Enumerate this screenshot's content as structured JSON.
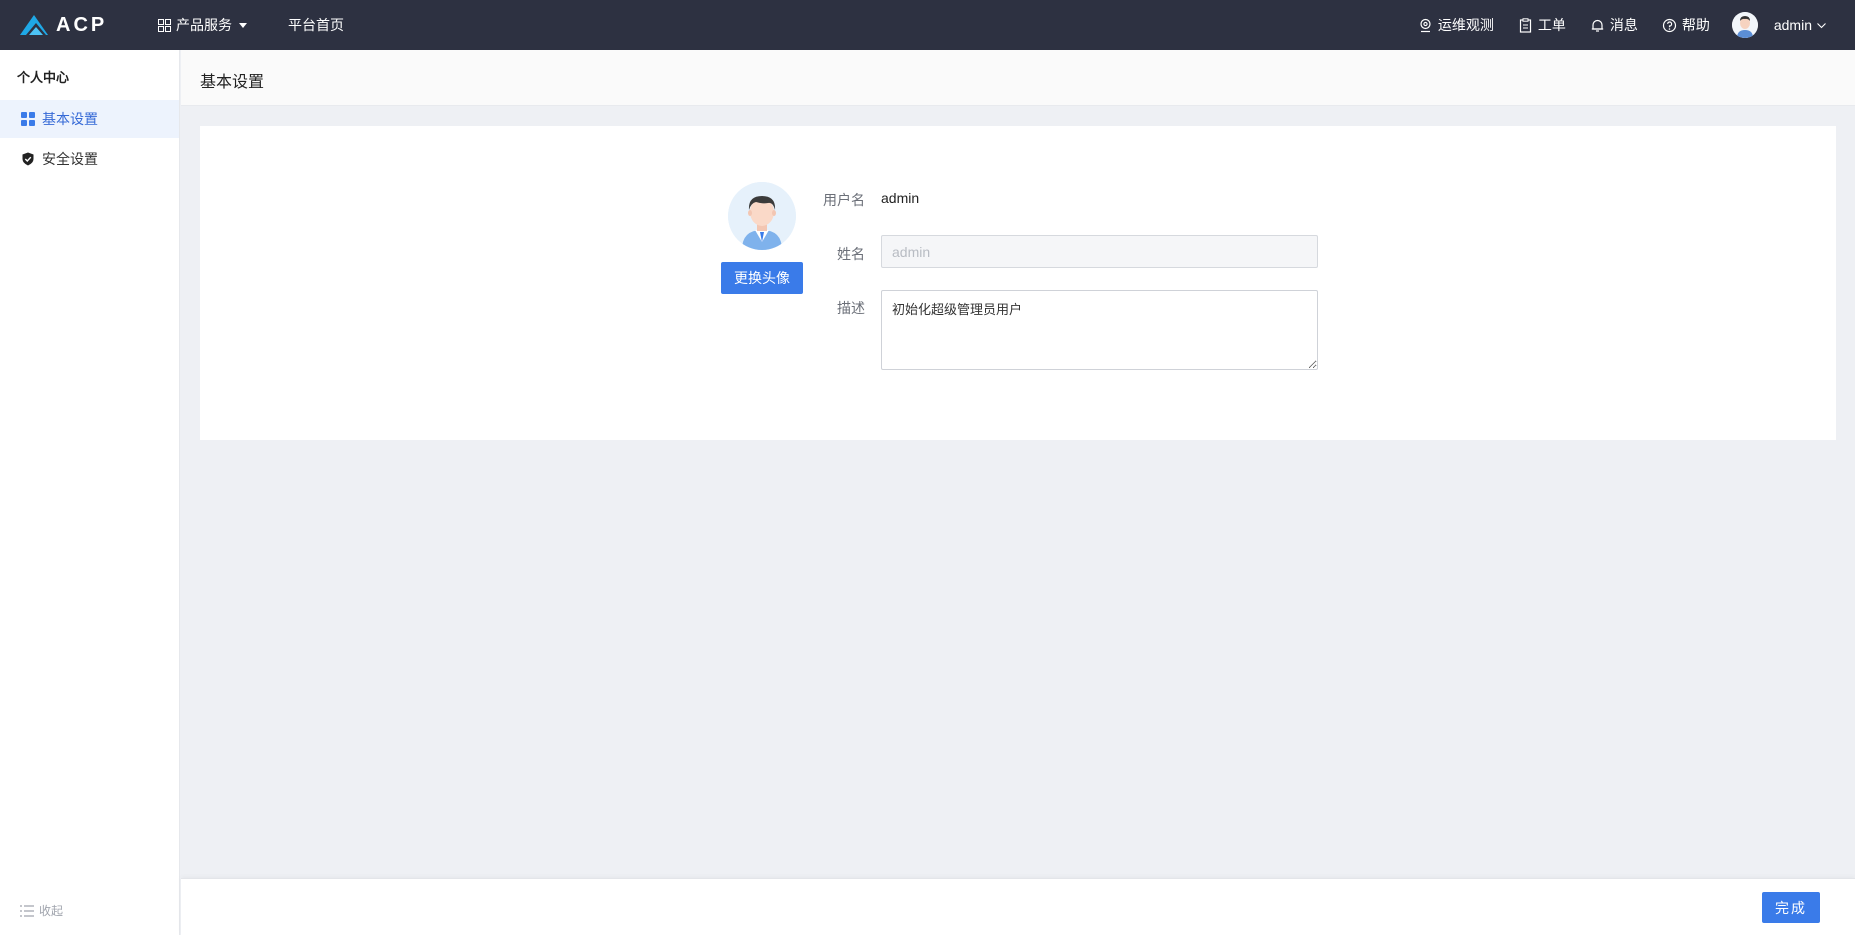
{
  "app": {
    "logo_text": "ACP",
    "brand_color": "#1fa8e6",
    "accent": "#3a7be9"
  },
  "topnav": {
    "products_label": "产品服务",
    "home_label": "平台首页",
    "right": {
      "ops_label": "运维观测",
      "ticket_label": "工单",
      "message_label": "消息",
      "help_label": "帮助",
      "user_label": "admin"
    }
  },
  "sidebar": {
    "title": "个人中心",
    "items": [
      {
        "label": "基本设置",
        "icon": "grid-icon",
        "active": true
      },
      {
        "label": "安全设置",
        "icon": "shield-check-icon",
        "active": false
      }
    ],
    "collapse_label": "收起"
  },
  "page": {
    "title": "基本设置"
  },
  "profile": {
    "change_avatar_label": "更换头像",
    "username_label": "用户名",
    "username_value": "admin",
    "name_label": "姓名",
    "name_placeholder": "admin",
    "name_value": "",
    "desc_label": "描述",
    "desc_value": "初始化超级管理员用户"
  },
  "footer": {
    "done_label": "完成"
  }
}
